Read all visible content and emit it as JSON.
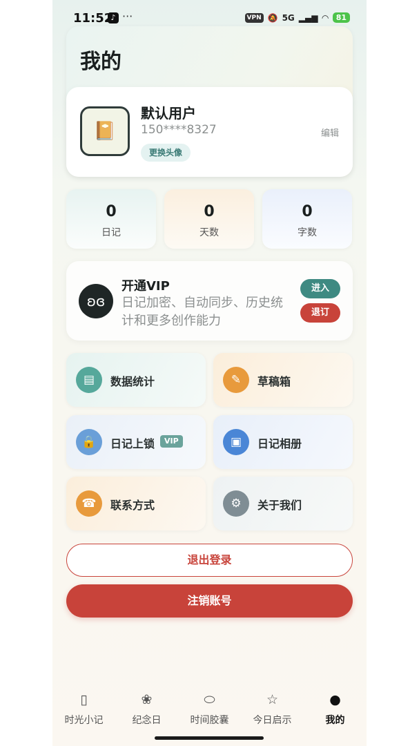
{
  "status_bar": {
    "time": "11:52",
    "dots": "···",
    "vpn": "VPN",
    "signal_5g": "5G",
    "battery": "81"
  },
  "header": {
    "title": "我的"
  },
  "user": {
    "name": "默认用户",
    "phone": "150****8327",
    "change_avatar": "更换头像",
    "edit": "编辑"
  },
  "stats": [
    {
      "value": "0",
      "label": "日记"
    },
    {
      "value": "0",
      "label": "天数"
    },
    {
      "value": "0",
      "label": "字数"
    }
  ],
  "vip": {
    "title": "开通VIP",
    "description": "日记加密、自动同步、历史统计和更多创作能力",
    "enter": "进入",
    "cancel": "退订"
  },
  "menu": [
    {
      "label": "数据统计",
      "icon": "stats-icon",
      "color": "#56a89b"
    },
    {
      "label": "草稿箱",
      "icon": "draft-icon",
      "color": "#e89a3c"
    },
    {
      "label": "日记上锁",
      "icon": "lock-icon",
      "color": "#6a9fd8",
      "tag": "VIP"
    },
    {
      "label": "日记相册",
      "icon": "album-icon",
      "color": "#4a86d6"
    },
    {
      "label": "联系方式",
      "icon": "phone-icon",
      "color": "#e89a3c"
    },
    {
      "label": "关于我们",
      "icon": "gear-icon",
      "color": "#7f8d94"
    }
  ],
  "actions": {
    "logout": "退出登录",
    "deactivate": "注销账号"
  },
  "tabs": [
    {
      "label": "时光小记",
      "icon": "notebook-icon"
    },
    {
      "label": "纪念日",
      "icon": "flower-icon"
    },
    {
      "label": "时间胶囊",
      "icon": "capsule-icon"
    },
    {
      "label": "今日启示",
      "icon": "star-icon"
    },
    {
      "label": "我的",
      "icon": "person-icon",
      "active": true
    }
  ]
}
